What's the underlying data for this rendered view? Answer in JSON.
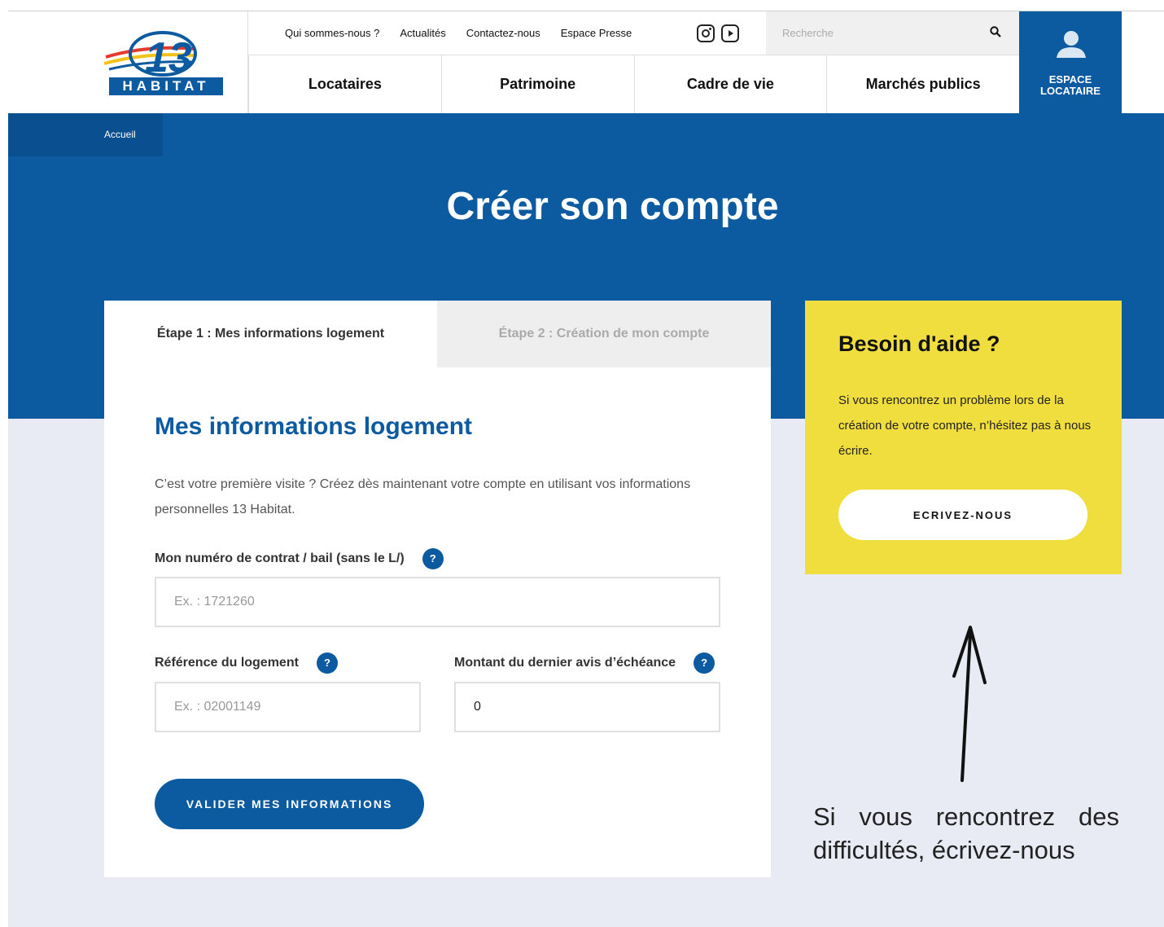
{
  "logo": {
    "number": "13",
    "wordmark": "HABITAT"
  },
  "topnav": {
    "links": [
      "Qui sommes-nous ?",
      "Actualités",
      "Contactez-nous",
      "Espace Presse"
    ],
    "social_icons": [
      "instagram-icon",
      "youtube-icon"
    ]
  },
  "search": {
    "placeholder": "Recherche",
    "icon": "search-icon"
  },
  "mainnav": {
    "items": [
      "Locataires",
      "Patrimoine",
      "Cadre de vie",
      "Marchés publics"
    ]
  },
  "espace_locataire": {
    "label_line1": "ESPACE",
    "label_line2": "LOCATAIRE",
    "icon": "user-icon"
  },
  "breadcrumb": {
    "home": "Accueil"
  },
  "page": {
    "title": "Créer son compte"
  },
  "tabs": [
    {
      "label": "Étape 1 : Mes informations logement",
      "active": true
    },
    {
      "label": "Étape 2 : Création de mon compte",
      "active": false
    }
  ],
  "form": {
    "section_title": "Mes informations logement",
    "intro": "C’est votre première visite ? Créez dès maintenant votre compte en utilisant vos informations personnelles 13 Habitat.",
    "help_glyph": "?",
    "contract": {
      "label": "Mon numéro de contrat / bail (sans le L/)",
      "placeholder": "Ex. : 1721260",
      "value": ""
    },
    "reference": {
      "label": "Référence du logement",
      "placeholder": "Ex. : 02001149",
      "value": ""
    },
    "amount": {
      "label": "Montant du dernier avis d’échéance",
      "value": "0"
    },
    "submit_label": "VALIDER MES INFORMATIONS"
  },
  "help": {
    "title": "Besoin d'aide ?",
    "text": "Si vous rencontrez un problème lors de la création de votre compte, n’hésitez pas à nous écrire.",
    "button_label": "ECRIVEZ-NOUS"
  },
  "annotation": {
    "text": "Si vous rencontrez des difficultés, écrivez-nous"
  },
  "colors": {
    "brand_blue": "#0c5aa0",
    "help_yellow": "#f0de3f",
    "page_bg": "#e8ebf3"
  }
}
